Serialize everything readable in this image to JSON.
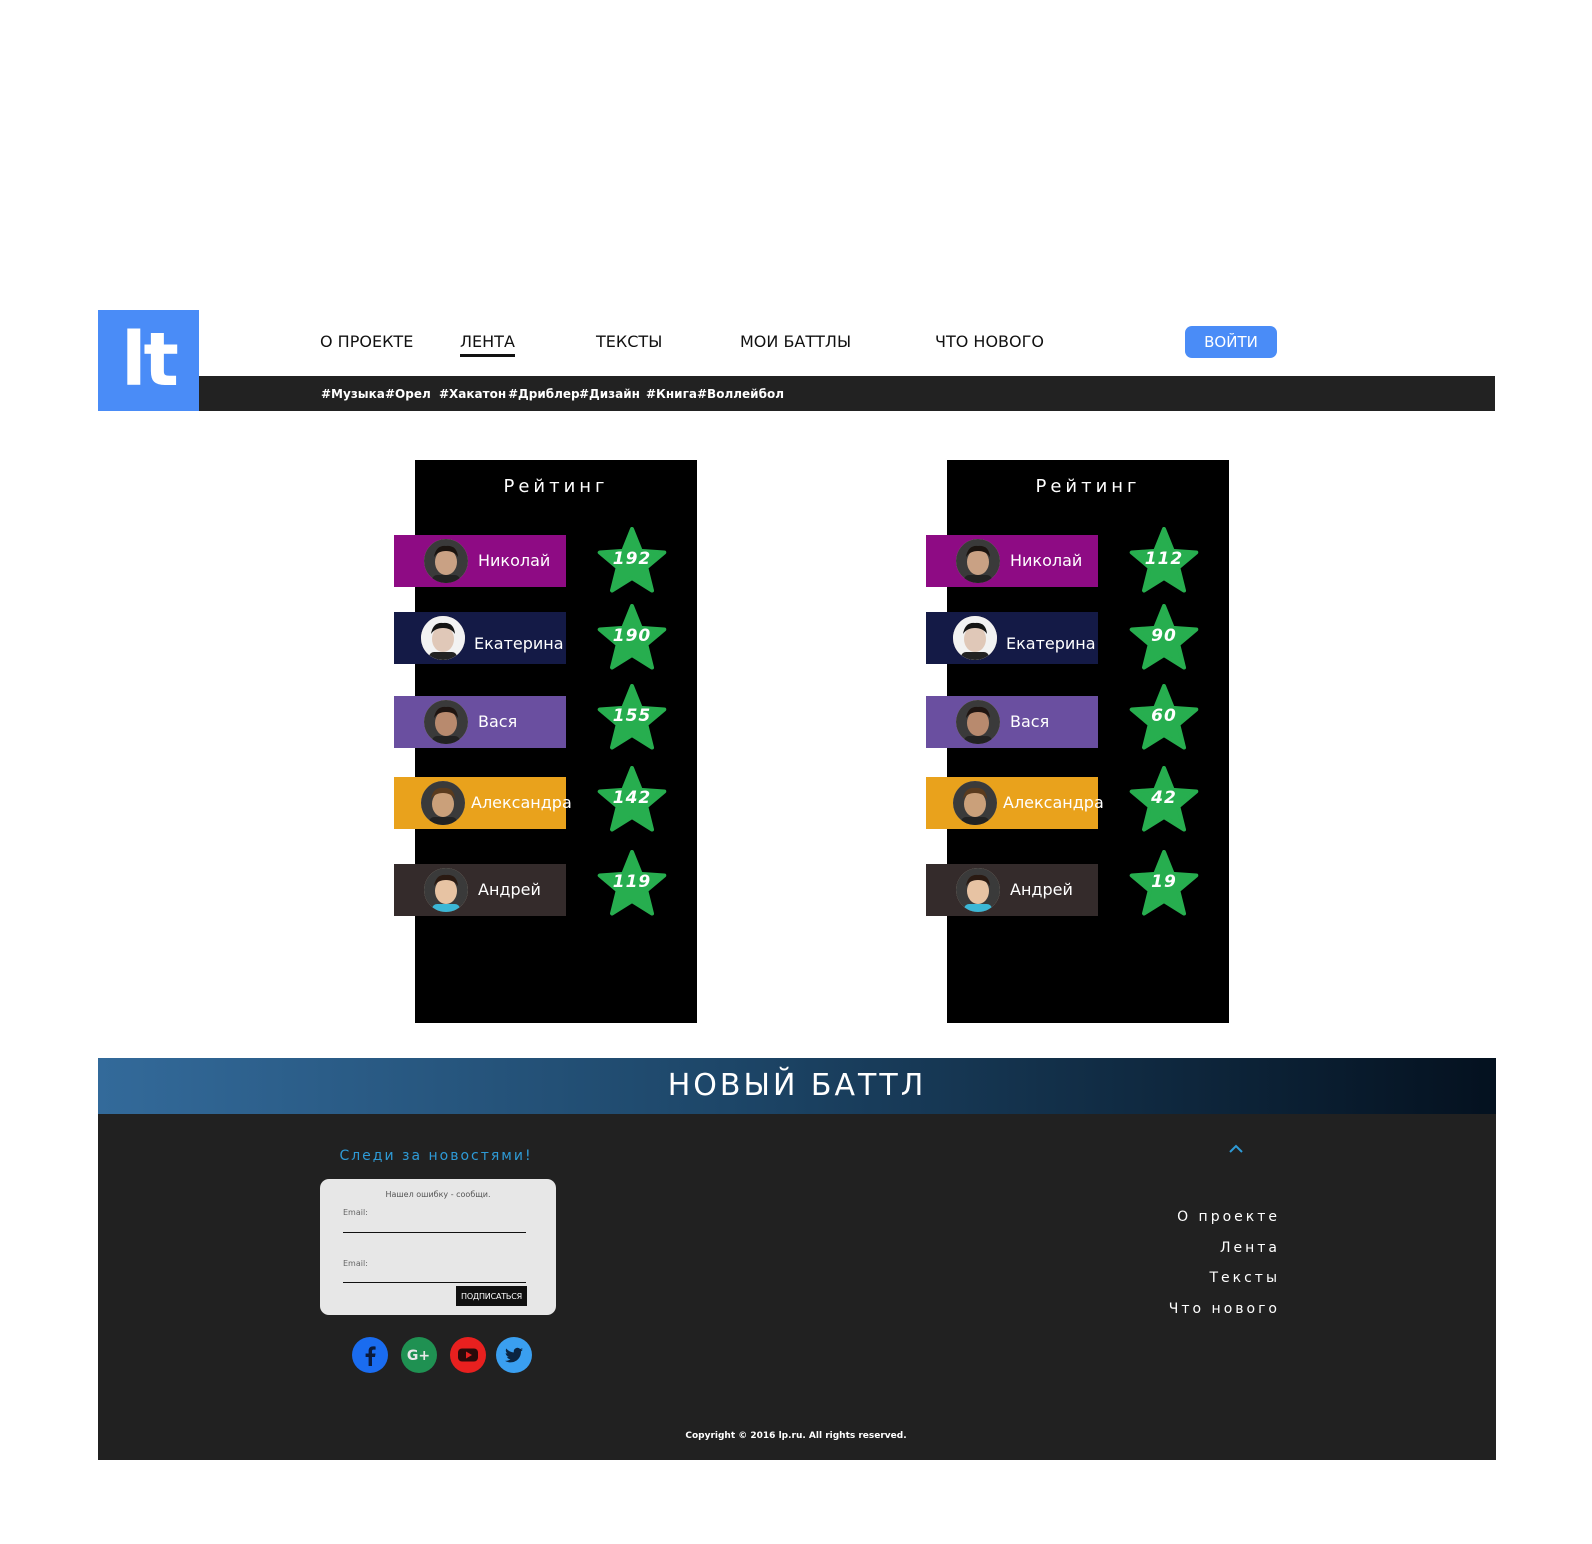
{
  "header": {
    "logo_text": "lt",
    "nav": [
      {
        "label": "О ПРОЕКТЕ"
      },
      {
        "label": "ЛЕНТА"
      },
      {
        "label": "ТЕКСТЫ"
      },
      {
        "label": "МОИ БАТТЛЫ"
      },
      {
        "label": "ЧТО НОВОГО"
      }
    ],
    "login_label": "ВОЙТИ",
    "tags": [
      "#Музыка",
      "#Орел",
      "#Хакатон",
      "#Дриблер",
      "#Дизайн",
      "#Книга",
      "#Воллейбол"
    ]
  },
  "ratings": [
    {
      "title": "Рейтинг",
      "users": [
        {
          "name": "Николай",
          "score": "192",
          "color": "#8e0b84"
        },
        {
          "name": "Екатерина",
          "score": "190",
          "color": "#141a46"
        },
        {
          "name": "Вася",
          "score": "155",
          "color": "#6a4fa0"
        },
        {
          "name": "Александра",
          "score": "142",
          "color": "#e9a21c"
        },
        {
          "name": "Андрей",
          "score": "119",
          "color": "#342b2b"
        }
      ]
    },
    {
      "title": "Рейтинг",
      "users": [
        {
          "name": "Николай",
          "score": "112",
          "color": "#8e0b84"
        },
        {
          "name": "Екатерина",
          "score": "90",
          "color": "#141a46"
        },
        {
          "name": "Вася",
          "score": "60",
          "color": "#6a4fa0"
        },
        {
          "name": "Александра",
          "score": "42",
          "color": "#e9a21c"
        },
        {
          "name": "Андрей",
          "score": "19",
          "color": "#342b2b"
        }
      ]
    }
  ],
  "star_color": "#27ae4f",
  "banner": {
    "title": "НОВЫЙ БАТТЛ"
  },
  "footer": {
    "follow_title": "Следи за новостями!",
    "subscribe": {
      "hint": "Нашел ошибку - сообщи.",
      "email_label_1": "Email:",
      "email_label_2": "Email:",
      "button_label": "ПОДПИСАТЬСЯ"
    },
    "social": [
      {
        "icon": "facebook-icon",
        "color": "#1a6cf0"
      },
      {
        "icon": "google-plus-icon",
        "color": "#1f9152"
      },
      {
        "icon": "youtube-icon",
        "color": "#e8201f"
      },
      {
        "icon": "twitter-icon",
        "color": "#3a9ff0"
      }
    ],
    "links": [
      "О проекте",
      "Лента",
      "Тексты",
      "Что нового"
    ],
    "copyright": "Copyright © 2016 lp.ru. All rights reserved."
  }
}
